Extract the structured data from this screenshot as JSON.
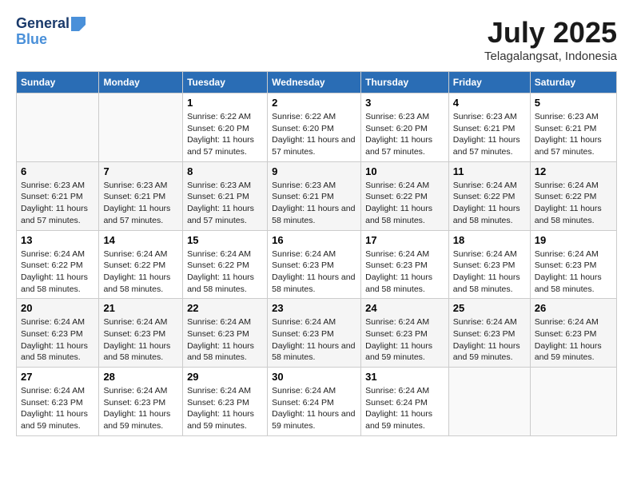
{
  "logo": {
    "line1": "General",
    "line2": "Blue"
  },
  "title": "July 2025",
  "location": "Telagalangsat, Indonesia",
  "days_header": [
    "Sunday",
    "Monday",
    "Tuesday",
    "Wednesday",
    "Thursday",
    "Friday",
    "Saturday"
  ],
  "weeks": [
    [
      {
        "day": "",
        "info": ""
      },
      {
        "day": "",
        "info": ""
      },
      {
        "day": "1",
        "info": "Sunrise: 6:22 AM\nSunset: 6:20 PM\nDaylight: 11 hours and 57 minutes."
      },
      {
        "day": "2",
        "info": "Sunrise: 6:22 AM\nSunset: 6:20 PM\nDaylight: 11 hours and 57 minutes."
      },
      {
        "day": "3",
        "info": "Sunrise: 6:23 AM\nSunset: 6:20 PM\nDaylight: 11 hours and 57 minutes."
      },
      {
        "day": "4",
        "info": "Sunrise: 6:23 AM\nSunset: 6:21 PM\nDaylight: 11 hours and 57 minutes."
      },
      {
        "day": "5",
        "info": "Sunrise: 6:23 AM\nSunset: 6:21 PM\nDaylight: 11 hours and 57 minutes."
      }
    ],
    [
      {
        "day": "6",
        "info": "Sunrise: 6:23 AM\nSunset: 6:21 PM\nDaylight: 11 hours and 57 minutes."
      },
      {
        "day": "7",
        "info": "Sunrise: 6:23 AM\nSunset: 6:21 PM\nDaylight: 11 hours and 57 minutes."
      },
      {
        "day": "8",
        "info": "Sunrise: 6:23 AM\nSunset: 6:21 PM\nDaylight: 11 hours and 57 minutes."
      },
      {
        "day": "9",
        "info": "Sunrise: 6:23 AM\nSunset: 6:21 PM\nDaylight: 11 hours and 58 minutes."
      },
      {
        "day": "10",
        "info": "Sunrise: 6:24 AM\nSunset: 6:22 PM\nDaylight: 11 hours and 58 minutes."
      },
      {
        "day": "11",
        "info": "Sunrise: 6:24 AM\nSunset: 6:22 PM\nDaylight: 11 hours and 58 minutes."
      },
      {
        "day": "12",
        "info": "Sunrise: 6:24 AM\nSunset: 6:22 PM\nDaylight: 11 hours and 58 minutes."
      }
    ],
    [
      {
        "day": "13",
        "info": "Sunrise: 6:24 AM\nSunset: 6:22 PM\nDaylight: 11 hours and 58 minutes."
      },
      {
        "day": "14",
        "info": "Sunrise: 6:24 AM\nSunset: 6:22 PM\nDaylight: 11 hours and 58 minutes."
      },
      {
        "day": "15",
        "info": "Sunrise: 6:24 AM\nSunset: 6:22 PM\nDaylight: 11 hours and 58 minutes."
      },
      {
        "day": "16",
        "info": "Sunrise: 6:24 AM\nSunset: 6:23 PM\nDaylight: 11 hours and 58 minutes."
      },
      {
        "day": "17",
        "info": "Sunrise: 6:24 AM\nSunset: 6:23 PM\nDaylight: 11 hours and 58 minutes."
      },
      {
        "day": "18",
        "info": "Sunrise: 6:24 AM\nSunset: 6:23 PM\nDaylight: 11 hours and 58 minutes."
      },
      {
        "day": "19",
        "info": "Sunrise: 6:24 AM\nSunset: 6:23 PM\nDaylight: 11 hours and 58 minutes."
      }
    ],
    [
      {
        "day": "20",
        "info": "Sunrise: 6:24 AM\nSunset: 6:23 PM\nDaylight: 11 hours and 58 minutes."
      },
      {
        "day": "21",
        "info": "Sunrise: 6:24 AM\nSunset: 6:23 PM\nDaylight: 11 hours and 58 minutes."
      },
      {
        "day": "22",
        "info": "Sunrise: 6:24 AM\nSunset: 6:23 PM\nDaylight: 11 hours and 58 minutes."
      },
      {
        "day": "23",
        "info": "Sunrise: 6:24 AM\nSunset: 6:23 PM\nDaylight: 11 hours and 58 minutes."
      },
      {
        "day": "24",
        "info": "Sunrise: 6:24 AM\nSunset: 6:23 PM\nDaylight: 11 hours and 59 minutes."
      },
      {
        "day": "25",
        "info": "Sunrise: 6:24 AM\nSunset: 6:23 PM\nDaylight: 11 hours and 59 minutes."
      },
      {
        "day": "26",
        "info": "Sunrise: 6:24 AM\nSunset: 6:23 PM\nDaylight: 11 hours and 59 minutes."
      }
    ],
    [
      {
        "day": "27",
        "info": "Sunrise: 6:24 AM\nSunset: 6:23 PM\nDaylight: 11 hours and 59 minutes."
      },
      {
        "day": "28",
        "info": "Sunrise: 6:24 AM\nSunset: 6:23 PM\nDaylight: 11 hours and 59 minutes."
      },
      {
        "day": "29",
        "info": "Sunrise: 6:24 AM\nSunset: 6:23 PM\nDaylight: 11 hours and 59 minutes."
      },
      {
        "day": "30",
        "info": "Sunrise: 6:24 AM\nSunset: 6:24 PM\nDaylight: 11 hours and 59 minutes."
      },
      {
        "day": "31",
        "info": "Sunrise: 6:24 AM\nSunset: 6:24 PM\nDaylight: 11 hours and 59 minutes."
      },
      {
        "day": "",
        "info": ""
      },
      {
        "day": "",
        "info": ""
      }
    ]
  ]
}
